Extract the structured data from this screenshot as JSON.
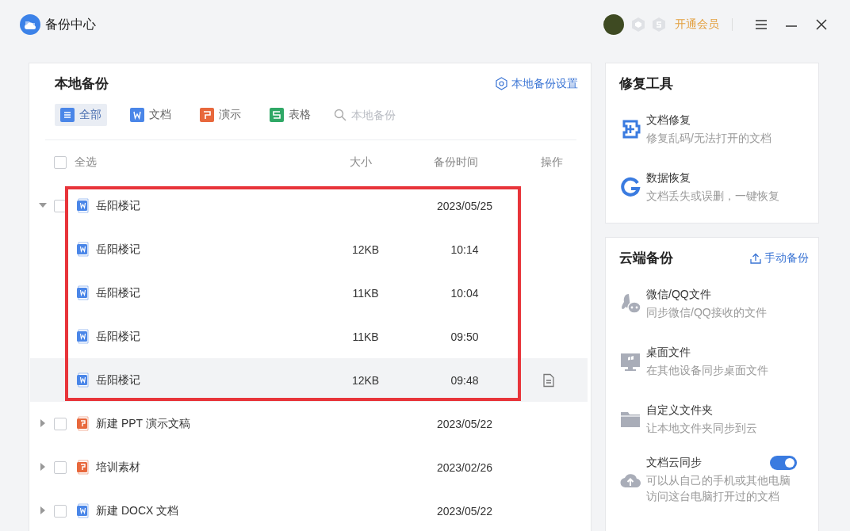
{
  "window": {
    "title": "备份中心",
    "vip_label": "开通会员"
  },
  "local_backup": {
    "title": "本地备份",
    "settings_link": "本地备份设置",
    "filters": [
      {
        "label": "全部",
        "kind": "all",
        "selected": true
      },
      {
        "label": "文档",
        "kind": "doc",
        "selected": false
      },
      {
        "label": "演示",
        "kind": "ppt",
        "selected": false
      },
      {
        "label": "表格",
        "kind": "sheet",
        "selected": false
      }
    ],
    "search": {
      "placeholder": "本地备份"
    },
    "columns": {
      "select_all": "全选",
      "select_all_checked": false,
      "size": "大小",
      "time": "备份时间",
      "action": "操作"
    },
    "files": [
      {
        "name": "岳阳楼记",
        "kind": "doc",
        "date": "2023/05/25",
        "expanded": true,
        "checked": false,
        "children": [
          {
            "name": "岳阳楼记",
            "kind": "doc",
            "size": "12KB",
            "time": "10:14",
            "hovered": false
          },
          {
            "name": "岳阳楼记",
            "kind": "doc",
            "size": "11KB",
            "time": "10:04",
            "hovered": false
          },
          {
            "name": "岳阳楼记",
            "kind": "doc",
            "size": "11KB",
            "time": "09:50",
            "hovered": false
          },
          {
            "name": "岳阳楼记",
            "kind": "doc",
            "size": "12KB",
            "time": "09:48",
            "hovered": true
          }
        ]
      },
      {
        "name": "新建 PPT 演示文稿",
        "kind": "ppt",
        "date": "2023/05/22",
        "expanded": false,
        "checked": false
      },
      {
        "name": "培训素材",
        "kind": "ppt",
        "date": "2023/02/26",
        "expanded": false,
        "checked": false
      },
      {
        "name": "新建 DOCX 文档",
        "kind": "doc",
        "date": "2023/05/22",
        "expanded": false,
        "checked": false
      }
    ]
  },
  "repair_tools": {
    "title": "修复工具",
    "items": [
      {
        "kind": "repair",
        "title": "文档修复",
        "desc": "修复乱码/无法打开的文档"
      },
      {
        "kind": "recover",
        "title": "数据恢复",
        "desc": "文档丢失或误删，一键恢复"
      }
    ]
  },
  "cloud_backup": {
    "title": "云端备份",
    "action": "手动备份",
    "items": [
      {
        "kind": "chat",
        "title": "微信/QQ文件",
        "desc": "同步微信/QQ接收的文件"
      },
      {
        "kind": "desktop",
        "title": "桌面文件",
        "desc": "在其他设备同步桌面文件"
      },
      {
        "kind": "folder",
        "title": "自定义文件夹",
        "desc": "让本地文件夹同步到云"
      },
      {
        "kind": "cloud",
        "title": "文档云同步",
        "desc": "可以从自己的手机或其他电脑访问这台电脑打开过的文档",
        "toggle": {
          "on": true
        }
      }
    ]
  }
}
